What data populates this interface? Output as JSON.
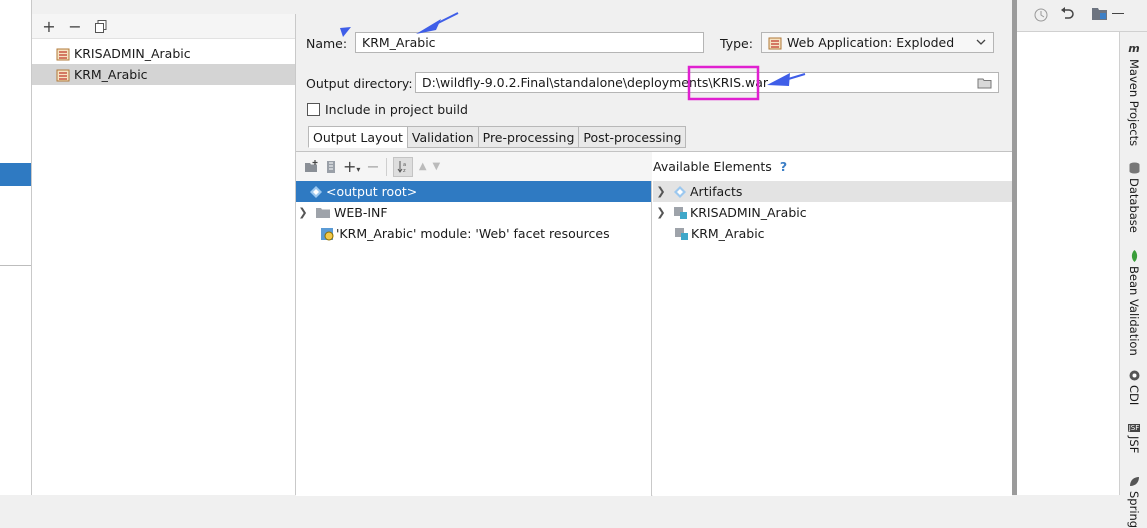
{
  "artifacts_panel": {
    "items": [
      {
        "label": "KRISADMIN_Arabic",
        "selected": false
      },
      {
        "label": "KRM_Arabic",
        "selected": true
      }
    ]
  },
  "config": {
    "name_label": "Name:",
    "name_value": "KRM_Arabic",
    "type_label": "Type:",
    "type_value": "Web Application: Exploded",
    "output_dir_label": "Output directory:",
    "output_dir_value": "D:\\wildfly-9.0.2.Final\\standalone\\deployments\\KRIS.war",
    "include_label": "Include in project build",
    "include_checked": false,
    "tabs": [
      {
        "label": "Output Layout",
        "active": true
      },
      {
        "label": "Validation",
        "active": false
      },
      {
        "label": "Pre-processing",
        "active": false
      },
      {
        "label": "Post-processing",
        "active": false
      }
    ]
  },
  "output_layout": {
    "tree": [
      {
        "label": "<output root>",
        "selected": true
      },
      {
        "label": "WEB-INF"
      },
      {
        "label": "'KRM_Arabic' module: 'Web' facet resources"
      }
    ]
  },
  "available_elements": {
    "title": "Available Elements",
    "help": "?",
    "tree": [
      {
        "label": "Artifacts"
      },
      {
        "label": "KRISADMIN_Arabic"
      },
      {
        "label": "KRM_Arabic"
      }
    ]
  },
  "ide_side_tabs": [
    "Maven Projects",
    "Database",
    "Bean Validation",
    "CDI",
    "JSF",
    "Spring"
  ],
  "colors": {
    "selection": "#2f7ac2",
    "annotation_arrow": "#3f5ee8",
    "annotation_box": "#e020d0"
  }
}
